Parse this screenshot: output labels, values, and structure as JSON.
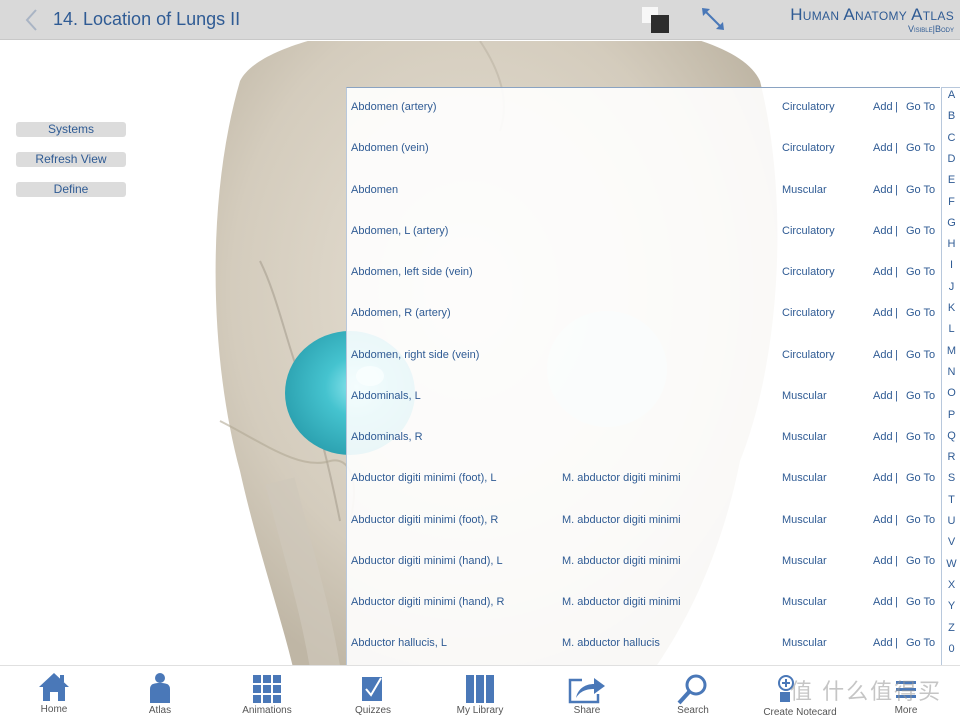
{
  "header": {
    "title": "14. Location of Lungs II",
    "brand_main": "Human Anatomy Atlas",
    "brand_sub": "Visible|Body"
  },
  "side_buttons": [
    {
      "label": "Systems"
    },
    {
      "label": "Refresh View"
    },
    {
      "label": "Define"
    }
  ],
  "list": {
    "action_add": "Add",
    "action_separator": "|",
    "action_goto": "Go To",
    "rows": [
      {
        "name": "Abdomen (artery)",
        "latin": "",
        "system": "Circulatory"
      },
      {
        "name": "Abdomen (vein)",
        "latin": "",
        "system": "Circulatory"
      },
      {
        "name": "Abdomen",
        "latin": "",
        "system": "Muscular"
      },
      {
        "name": "Abdomen, L (artery)",
        "latin": "",
        "system": "Circulatory"
      },
      {
        "name": "Abdomen, left side (vein)",
        "latin": "",
        "system": "Circulatory"
      },
      {
        "name": "Abdomen, R (artery)",
        "latin": "",
        "system": "Circulatory"
      },
      {
        "name": "Abdomen, right side (vein)",
        "latin": "",
        "system": "Circulatory"
      },
      {
        "name": "Abdominals, L",
        "latin": "",
        "system": "Muscular"
      },
      {
        "name": "Abdominals, R",
        "latin": "",
        "system": "Muscular"
      },
      {
        "name": "Abductor digiti minimi (foot), L",
        "latin": "M. abductor digiti minimi",
        "system": "Muscular"
      },
      {
        "name": "Abductor digiti minimi (foot), R",
        "latin": "M. abductor digiti minimi",
        "system": "Muscular"
      },
      {
        "name": "Abductor digiti minimi (hand), L",
        "latin": "M. abductor digiti minimi",
        "system": "Muscular"
      },
      {
        "name": "Abductor digiti minimi (hand), R",
        "latin": "M. abductor digiti minimi",
        "system": "Muscular"
      },
      {
        "name": "Abductor hallucis, L",
        "latin": "M. abductor hallucis",
        "system": "Muscular"
      }
    ]
  },
  "alphabet_index": [
    "A",
    "B",
    "C",
    "D",
    "E",
    "F",
    "G",
    "H",
    "I",
    "J",
    "K",
    "L",
    "M",
    "N",
    "O",
    "P",
    "Q",
    "R",
    "S",
    "T",
    "U",
    "V",
    "W",
    "X",
    "Y",
    "Z",
    "0"
  ],
  "bottom_nav": [
    {
      "label": "Home",
      "icon": "home-icon"
    },
    {
      "label": "Atlas",
      "icon": "body-icon"
    },
    {
      "label": "Animations",
      "icon": "grid-icon"
    },
    {
      "label": "Quizzes",
      "icon": "checkbox-icon"
    },
    {
      "label": "My Library",
      "icon": "library-icon"
    },
    {
      "label": "Share",
      "icon": "share-icon"
    },
    {
      "label": "Search",
      "icon": "search-icon"
    },
    {
      "label": "Create Notecard",
      "icon": "notecard-icon"
    },
    {
      "label": "More",
      "icon": "more-icon"
    }
  ],
  "watermark": "值 什么值得买",
  "colors": {
    "accent": "#2f5b94",
    "icon_blue": "#4a78b8",
    "highlight_teal": "#3fbccc",
    "topbar": "#d9d9d9"
  }
}
